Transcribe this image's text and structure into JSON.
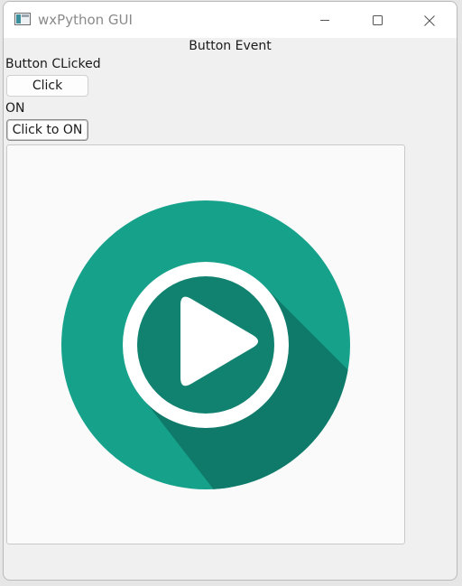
{
  "window": {
    "title": "wxPython GUI",
    "icons": {
      "app": "app-window-icon",
      "minimize": "minimize-icon",
      "maximize": "maximize-icon",
      "close": "close-icon"
    }
  },
  "content": {
    "title_label": "Button Event",
    "status_label": "Button CLicked",
    "click_button_label": "Click",
    "toggle_state_label": "ON",
    "toggle_button_label": "Click to ON",
    "image": {
      "icon": "play-icon",
      "circle_color": "#16a18b",
      "inner_color": "#128270",
      "shadow_color": "#0f7a69",
      "ring_color": "#ffffff"
    }
  }
}
